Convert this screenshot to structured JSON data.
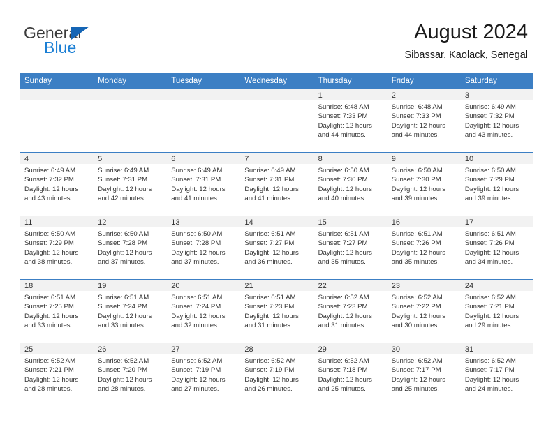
{
  "logo": {
    "word1": "General",
    "word2": "Blue",
    "triangle_color": "#1565b5",
    "blue_color": "#1b7fd4"
  },
  "header": {
    "title": "August 2024",
    "subtitle": "Sibassar, Kaolack, Senegal"
  },
  "theme": {
    "header_bg": "#3c7fc4",
    "daynum_bg": "#f2f2f2",
    "text": "#333333"
  },
  "calendar": {
    "weekday_headers": [
      "Sunday",
      "Monday",
      "Tuesday",
      "Wednesday",
      "Thursday",
      "Friday",
      "Saturday"
    ],
    "weeks": [
      [
        {
          "day": "",
          "lines": []
        },
        {
          "day": "",
          "lines": []
        },
        {
          "day": "",
          "lines": []
        },
        {
          "day": "",
          "lines": []
        },
        {
          "day": "1",
          "lines": [
            "Sunrise: 6:48 AM",
            "Sunset: 7:33 PM",
            "Daylight: 12 hours",
            "and 44 minutes."
          ]
        },
        {
          "day": "2",
          "lines": [
            "Sunrise: 6:48 AM",
            "Sunset: 7:33 PM",
            "Daylight: 12 hours",
            "and 44 minutes."
          ]
        },
        {
          "day": "3",
          "lines": [
            "Sunrise: 6:49 AM",
            "Sunset: 7:32 PM",
            "Daylight: 12 hours",
            "and 43 minutes."
          ]
        }
      ],
      [
        {
          "day": "4",
          "lines": [
            "Sunrise: 6:49 AM",
            "Sunset: 7:32 PM",
            "Daylight: 12 hours",
            "and 43 minutes."
          ]
        },
        {
          "day": "5",
          "lines": [
            "Sunrise: 6:49 AM",
            "Sunset: 7:31 PM",
            "Daylight: 12 hours",
            "and 42 minutes."
          ]
        },
        {
          "day": "6",
          "lines": [
            "Sunrise: 6:49 AM",
            "Sunset: 7:31 PM",
            "Daylight: 12 hours",
            "and 41 minutes."
          ]
        },
        {
          "day": "7",
          "lines": [
            "Sunrise: 6:49 AM",
            "Sunset: 7:31 PM",
            "Daylight: 12 hours",
            "and 41 minutes."
          ]
        },
        {
          "day": "8",
          "lines": [
            "Sunrise: 6:50 AM",
            "Sunset: 7:30 PM",
            "Daylight: 12 hours",
            "and 40 minutes."
          ]
        },
        {
          "day": "9",
          "lines": [
            "Sunrise: 6:50 AM",
            "Sunset: 7:30 PM",
            "Daylight: 12 hours",
            "and 39 minutes."
          ]
        },
        {
          "day": "10",
          "lines": [
            "Sunrise: 6:50 AM",
            "Sunset: 7:29 PM",
            "Daylight: 12 hours",
            "and 39 minutes."
          ]
        }
      ],
      [
        {
          "day": "11",
          "lines": [
            "Sunrise: 6:50 AM",
            "Sunset: 7:29 PM",
            "Daylight: 12 hours",
            "and 38 minutes."
          ]
        },
        {
          "day": "12",
          "lines": [
            "Sunrise: 6:50 AM",
            "Sunset: 7:28 PM",
            "Daylight: 12 hours",
            "and 37 minutes."
          ]
        },
        {
          "day": "13",
          "lines": [
            "Sunrise: 6:50 AM",
            "Sunset: 7:28 PM",
            "Daylight: 12 hours",
            "and 37 minutes."
          ]
        },
        {
          "day": "14",
          "lines": [
            "Sunrise: 6:51 AM",
            "Sunset: 7:27 PM",
            "Daylight: 12 hours",
            "and 36 minutes."
          ]
        },
        {
          "day": "15",
          "lines": [
            "Sunrise: 6:51 AM",
            "Sunset: 7:27 PM",
            "Daylight: 12 hours",
            "and 35 minutes."
          ]
        },
        {
          "day": "16",
          "lines": [
            "Sunrise: 6:51 AM",
            "Sunset: 7:26 PM",
            "Daylight: 12 hours",
            "and 35 minutes."
          ]
        },
        {
          "day": "17",
          "lines": [
            "Sunrise: 6:51 AM",
            "Sunset: 7:26 PM",
            "Daylight: 12 hours",
            "and 34 minutes."
          ]
        }
      ],
      [
        {
          "day": "18",
          "lines": [
            "Sunrise: 6:51 AM",
            "Sunset: 7:25 PM",
            "Daylight: 12 hours",
            "and 33 minutes."
          ]
        },
        {
          "day": "19",
          "lines": [
            "Sunrise: 6:51 AM",
            "Sunset: 7:24 PM",
            "Daylight: 12 hours",
            "and 33 minutes."
          ]
        },
        {
          "day": "20",
          "lines": [
            "Sunrise: 6:51 AM",
            "Sunset: 7:24 PM",
            "Daylight: 12 hours",
            "and 32 minutes."
          ]
        },
        {
          "day": "21",
          "lines": [
            "Sunrise: 6:51 AM",
            "Sunset: 7:23 PM",
            "Daylight: 12 hours",
            "and 31 minutes."
          ]
        },
        {
          "day": "22",
          "lines": [
            "Sunrise: 6:52 AM",
            "Sunset: 7:23 PM",
            "Daylight: 12 hours",
            "and 31 minutes."
          ]
        },
        {
          "day": "23",
          "lines": [
            "Sunrise: 6:52 AM",
            "Sunset: 7:22 PM",
            "Daylight: 12 hours",
            "and 30 minutes."
          ]
        },
        {
          "day": "24",
          "lines": [
            "Sunrise: 6:52 AM",
            "Sunset: 7:21 PM",
            "Daylight: 12 hours",
            "and 29 minutes."
          ]
        }
      ],
      [
        {
          "day": "25",
          "lines": [
            "Sunrise: 6:52 AM",
            "Sunset: 7:21 PM",
            "Daylight: 12 hours",
            "and 28 minutes."
          ]
        },
        {
          "day": "26",
          "lines": [
            "Sunrise: 6:52 AM",
            "Sunset: 7:20 PM",
            "Daylight: 12 hours",
            "and 28 minutes."
          ]
        },
        {
          "day": "27",
          "lines": [
            "Sunrise: 6:52 AM",
            "Sunset: 7:19 PM",
            "Daylight: 12 hours",
            "and 27 minutes."
          ]
        },
        {
          "day": "28",
          "lines": [
            "Sunrise: 6:52 AM",
            "Sunset: 7:19 PM",
            "Daylight: 12 hours",
            "and 26 minutes."
          ]
        },
        {
          "day": "29",
          "lines": [
            "Sunrise: 6:52 AM",
            "Sunset: 7:18 PM",
            "Daylight: 12 hours",
            "and 25 minutes."
          ]
        },
        {
          "day": "30",
          "lines": [
            "Sunrise: 6:52 AM",
            "Sunset: 7:17 PM",
            "Daylight: 12 hours",
            "and 25 minutes."
          ]
        },
        {
          "day": "31",
          "lines": [
            "Sunrise: 6:52 AM",
            "Sunset: 7:17 PM",
            "Daylight: 12 hours",
            "and 24 minutes."
          ]
        }
      ]
    ]
  }
}
